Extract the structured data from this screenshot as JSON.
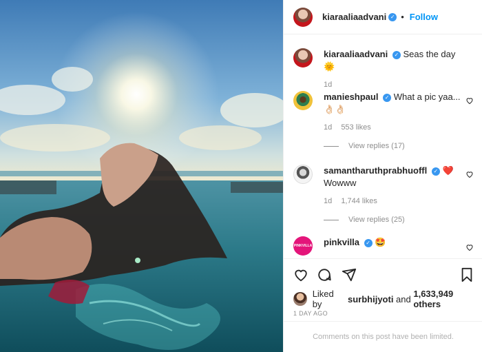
{
  "post": {
    "author": "kiaraaliaadvani",
    "follow_label": "Follow",
    "separator": "•",
    "caption": {
      "username": "kiaraaliaadvani",
      "text": "Seas the day ",
      "emoji": "🌞",
      "age": "1d"
    }
  },
  "comments": [
    {
      "username": "manieshpaul",
      "text": "What a pic yaa...👌🏻👌🏻",
      "age": "1d",
      "likes": "553 likes",
      "view_replies": "View replies (17)"
    },
    {
      "username": "samantharuthprabhuoffl",
      "emoji": "❤️",
      "text": "Wowww",
      "age": "1d",
      "likes": "1,744 likes",
      "view_replies": "View replies (25)"
    },
    {
      "username": "pinkvilla",
      "avatar_text": "PINKVILLA",
      "emoji": "🤩"
    }
  ],
  "likes": {
    "prefix": "Liked by ",
    "user": "surbhijyoti",
    "middle": " and ",
    "count": "1,633,949 others"
  },
  "timestamp": "1 DAY AGO",
  "footer_text": "Comments on this post have been limited.",
  "icons": [
    "verified-badge",
    "heart-icon",
    "comment-icon",
    "share-icon",
    "save-icon"
  ],
  "colors": {
    "link": "#0095f6",
    "verified": "#3897f0",
    "muted": "#8e8e8e"
  }
}
